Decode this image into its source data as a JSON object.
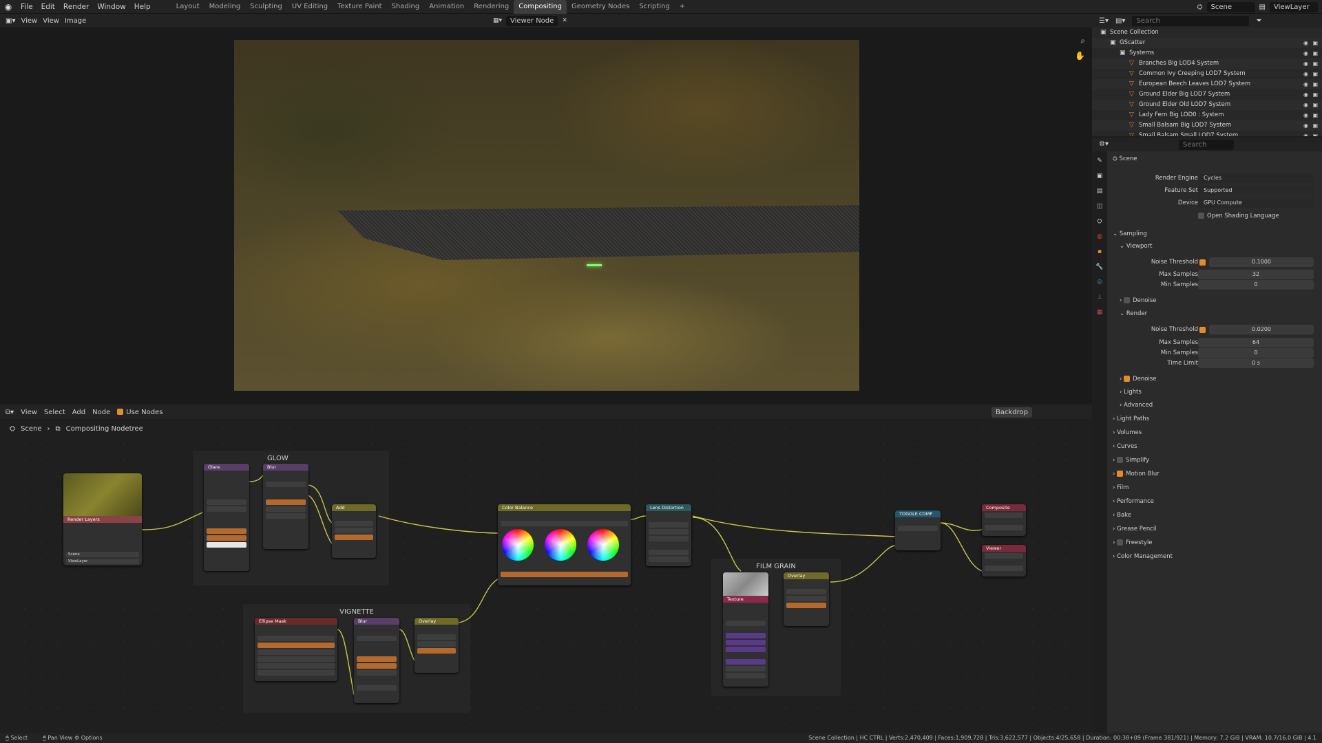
{
  "topbar": {
    "menus": [
      "File",
      "Edit",
      "Render",
      "Window",
      "Help"
    ],
    "workspaces": [
      "Layout",
      "Modeling",
      "Sculpting",
      "UV Editing",
      "Texture Paint",
      "Shading",
      "Animation",
      "Rendering",
      "Compositing",
      "Geometry Nodes",
      "Scripting"
    ],
    "active_workspace": "Compositing",
    "scene": "Scene",
    "view_layer": "ViewLayer"
  },
  "image_editor": {
    "view_label": "View",
    "menus": [
      "View",
      "Image"
    ],
    "image_name": "Viewer Node"
  },
  "outliner": {
    "search_placeholder": "Search",
    "rows": [
      {
        "label": "Scene Collection",
        "indent": 0
      },
      {
        "label": "GScatter",
        "indent": 1
      },
      {
        "label": "Systems",
        "indent": 2
      },
      {
        "label": "Branches Big LOD4 System",
        "indent": 3
      },
      {
        "label": "Common Ivy Creeping LOD7 System",
        "indent": 3
      },
      {
        "label": "European Beech Leaves LOD7 System",
        "indent": 3
      },
      {
        "label": "Ground Elder Big LOD7 System",
        "indent": 3
      },
      {
        "label": "Ground Elder Old LOD7 System",
        "indent": 3
      },
      {
        "label": "Lady Fern Big LOD0 : System",
        "indent": 3
      },
      {
        "label": "Small Balsam Big LOD7 System",
        "indent": 3
      },
      {
        "label": "Small Balsam Small LOD7 System",
        "indent": 3
      }
    ]
  },
  "properties": {
    "search_placeholder": "Search",
    "context": "Scene",
    "render_engine": {
      "label": "Render Engine",
      "value": "Cycles"
    },
    "feature_set": {
      "label": "Feature Set",
      "value": "Supported"
    },
    "device": {
      "label": "Device",
      "value": "GPU Compute"
    },
    "osl": "Open Shading Language",
    "sampling": "Sampling",
    "viewport": "Viewport",
    "vp_noise": {
      "label": "Noise Threshold",
      "value": "0.1000"
    },
    "vp_max": {
      "label": "Max Samples",
      "value": "32"
    },
    "vp_min": {
      "label": "Min Samples",
      "value": "0"
    },
    "denoise": "Denoise",
    "render": "Render",
    "r_noise": {
      "label": "Noise Threshold",
      "value": "0.0200"
    },
    "r_max": {
      "label": "Max Samples",
      "value": "64"
    },
    "r_min": {
      "label": "Min Samples",
      "value": "0"
    },
    "r_time": {
      "label": "Time Limit",
      "value": "0 s"
    },
    "denoise2": "Denoise",
    "lights": "Lights",
    "advanced": "Advanced",
    "sections": [
      "Light Paths",
      "Volumes",
      "Curves",
      "Simplify",
      "Motion Blur",
      "Film",
      "Performance",
      "Bake",
      "Grease Pencil",
      "Freestyle",
      "Color Management"
    ]
  },
  "node_editor": {
    "menus": [
      "View",
      "Select",
      "Add",
      "Node"
    ],
    "use_nodes": "Use Nodes",
    "backdrop": "Backdrop",
    "breadcrumb_scene": "Scene",
    "breadcrumb_tree": "Compositing Nodetree",
    "frames": {
      "glow": "GLOW",
      "vignette": "VIGNETTE",
      "film_grain": "FILM GRAIN"
    },
    "nodes": {
      "render_layers": "Render Layers",
      "glare": "Glare",
      "blur": "Blur",
      "add": "Add",
      "color_balance": "Color Balance",
      "lens_distortion": "Lens Distortion",
      "toggle_comp": "TOGGLE COMP",
      "composite": "Composite",
      "viewer": "Viewer",
      "ellipse_mask": "Ellipse Mask",
      "blur2": "Blur",
      "overlay": "Overlay",
      "texture": "Texture",
      "overlay2": "Overlay"
    },
    "rl_scene": "Scene",
    "rl_layer": "ViewLayer"
  },
  "status": {
    "left": [
      "Select",
      "Pan View",
      "Options"
    ],
    "right": "Scene Collection | HC CTRL | Verts:2,470,409 | Faces:1,909,728 | Tris:3,622,577 | Objects:4/25,658 | Duration: 00:38+09 (Frame 381/921) | Memory: 7.2 GiB | VRAM: 10.7/16.0 GiB | 4.1"
  },
  "colors": {
    "accent": "#e28f2a",
    "bg": "#1d1d1d",
    "panel": "#2b2b2b"
  }
}
